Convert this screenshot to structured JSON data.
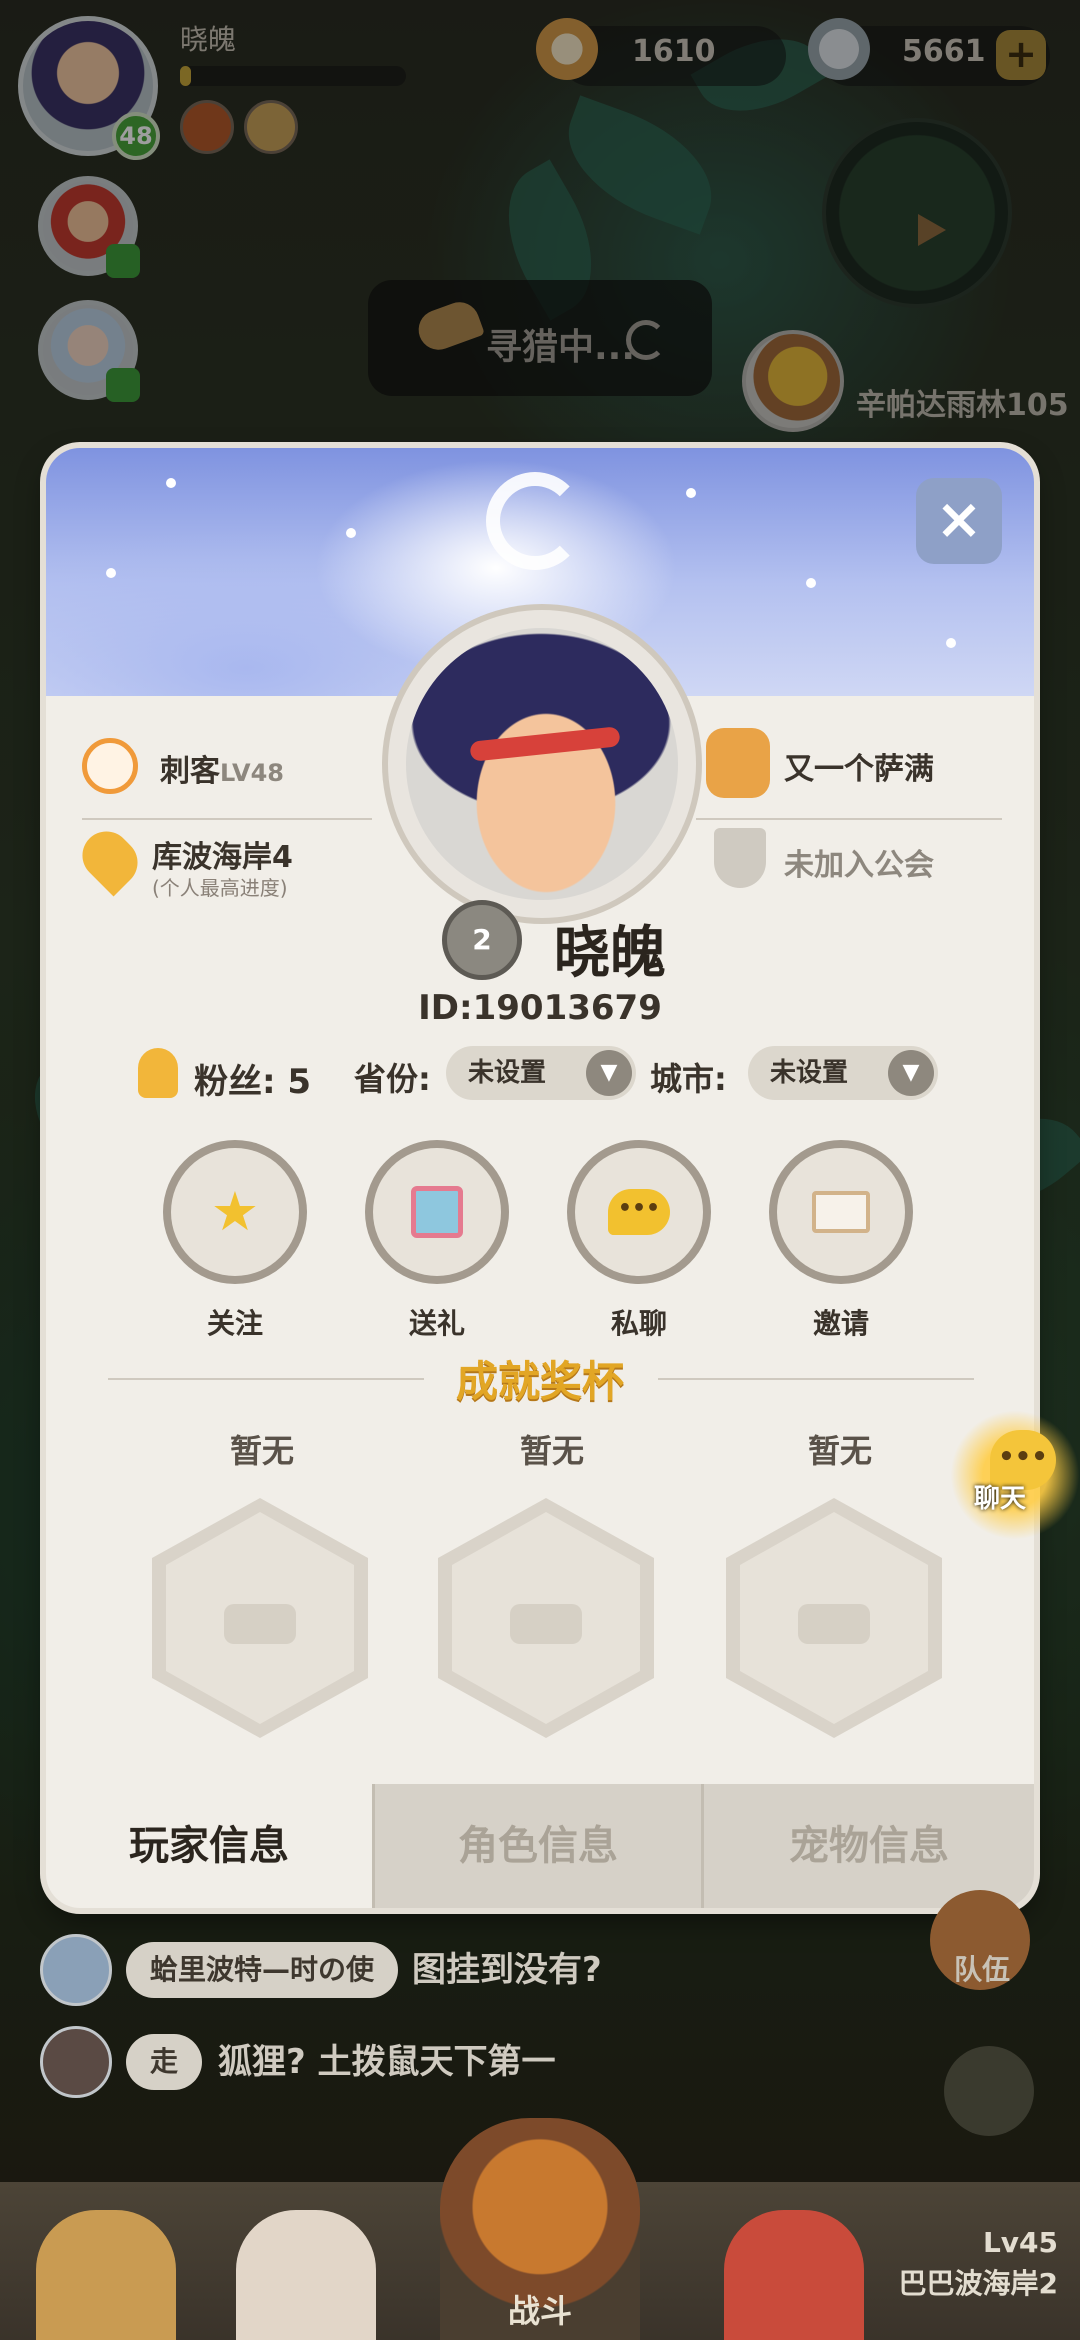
{
  "hud": {
    "player_name": "晓魄",
    "level": "48",
    "exp_fraction": 0.05,
    "currency_shells": "1610",
    "currency_pearls": "5661",
    "boss_label": "辛帕达雨林105"
  },
  "status": {
    "hunting": "寻猎中..."
  },
  "profile": {
    "close_glyph": "×",
    "class_label": "刺客",
    "class_level": "LV48",
    "location": "库波海岸4",
    "location_note": "(个人最高进度)",
    "partner": "又一个萨满",
    "guild": "未加入公会",
    "rank_number": "2",
    "name": "晓魄",
    "id_text": "ID:19013679",
    "fans": "粉丝: 5",
    "province_label": "省份:",
    "province_value": "未设置",
    "city_label": "城市:",
    "city_value": "未设置",
    "actions": [
      {
        "label": "关注",
        "icon": "star-icon"
      },
      {
        "label": "送礼",
        "icon": "gift-icon"
      },
      {
        "label": "私聊",
        "icon": "chat-bubble-icon"
      },
      {
        "label": "邀请",
        "icon": "envelope-icon"
      }
    ],
    "trophy_title": "成就奖杯",
    "trophies": [
      "暂无",
      "暂无",
      "暂无"
    ],
    "tabs": [
      "玩家信息",
      "角色信息",
      "宠物信息"
    ],
    "active_tab": "玩家信息"
  },
  "floating_chat": {
    "label": "聊天",
    "glyph": "•••"
  },
  "chat": [
    {
      "tag": "蛤里波特—时の使",
      "message": "图挂到没有?"
    },
    {
      "tag": "走",
      "message": "狐狸? 土拨鼠天下第一"
    }
  ],
  "team_label": "队伍",
  "nav": {
    "battle_label": "战斗",
    "locked_level": "Lv45",
    "locked_stage": "巴巴波海岸2"
  },
  "colors": {
    "modal_bg": "#f1eee8",
    "trophy_gold": "#e2a625",
    "accent_orange": "#f2b63a"
  }
}
